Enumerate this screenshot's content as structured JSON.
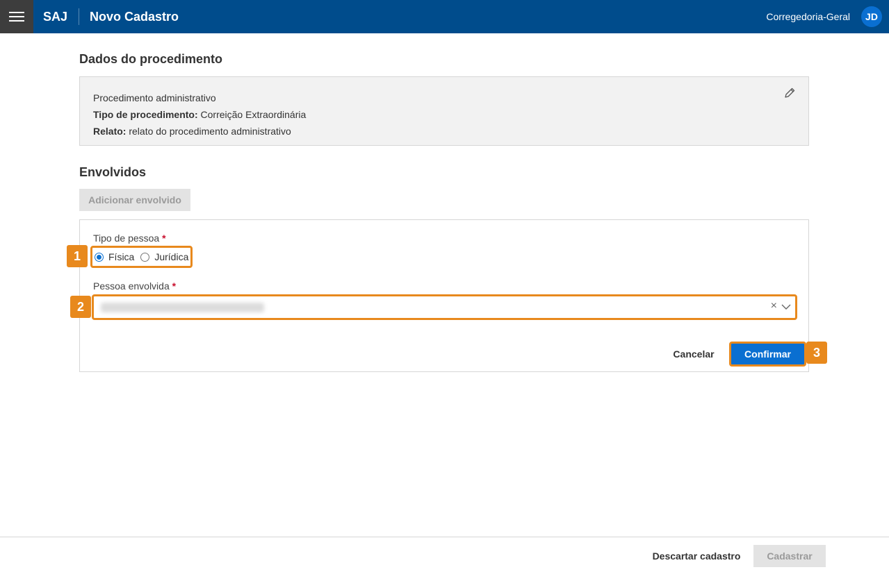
{
  "header": {
    "brand": "SAJ",
    "title": "Novo Cadastro",
    "organization": "Corregedoria-Geral",
    "avatar_initials": "JD"
  },
  "procedure": {
    "section_title": "Dados do procedimento",
    "type_line": "Procedimento administrativo",
    "kind_label": "Tipo de procedimento:",
    "kind_value": "Correição Extraordinária",
    "report_label": "Relato:",
    "report_value": "relato do procedimento administrativo"
  },
  "involved": {
    "section_title": "Envolvidos",
    "add_button": "Adicionar envolvido",
    "person_type_label": "Tipo de pessoa",
    "required_mark": "*",
    "options": [
      {
        "label": "Física",
        "checked": true
      },
      {
        "label": "Jurídica",
        "checked": false
      }
    ],
    "person_label": "Pessoa envolvida",
    "person_value_blurred": true,
    "clear_icon": "×",
    "cancel_button": "Cancelar",
    "confirm_button": "Confirmar"
  },
  "annotations": {
    "step1": "1",
    "step2": "2",
    "step3": "3",
    "highlight_color": "#e8891d"
  },
  "footer": {
    "discard_button": "Descartar cadastro",
    "submit_button": "Cadastrar"
  },
  "colors": {
    "header_bg": "#004c8c",
    "primary": "#0a6fd1",
    "required": "#c8102e"
  }
}
